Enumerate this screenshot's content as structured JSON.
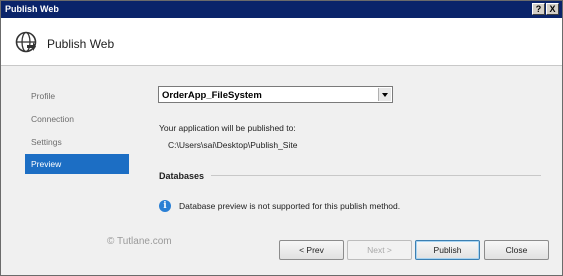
{
  "window": {
    "title": "Publish Web",
    "help_button": "?",
    "close_button": "X"
  },
  "header": {
    "title": "Publish Web"
  },
  "nav": {
    "items": [
      {
        "label": "Profile"
      },
      {
        "label": "Connection"
      },
      {
        "label": "Settings"
      },
      {
        "label": "Preview",
        "active": true
      }
    ]
  },
  "profile_select": {
    "value": "OrderApp_FileSystem"
  },
  "publish": {
    "message": "Your application will be published to:",
    "path": "C:\\Users\\sai\\Desktop\\Publish_Site"
  },
  "databases": {
    "heading": "Databases",
    "info": "Database preview is not supported for this publish method."
  },
  "watermark": "© Tutlane.com",
  "buttons": {
    "prev": "< Prev",
    "next": "Next >",
    "publish": "Publish",
    "close": "Close"
  },
  "colors": {
    "accent": "#1c6ec4",
    "titlebar": "#0a246a"
  }
}
